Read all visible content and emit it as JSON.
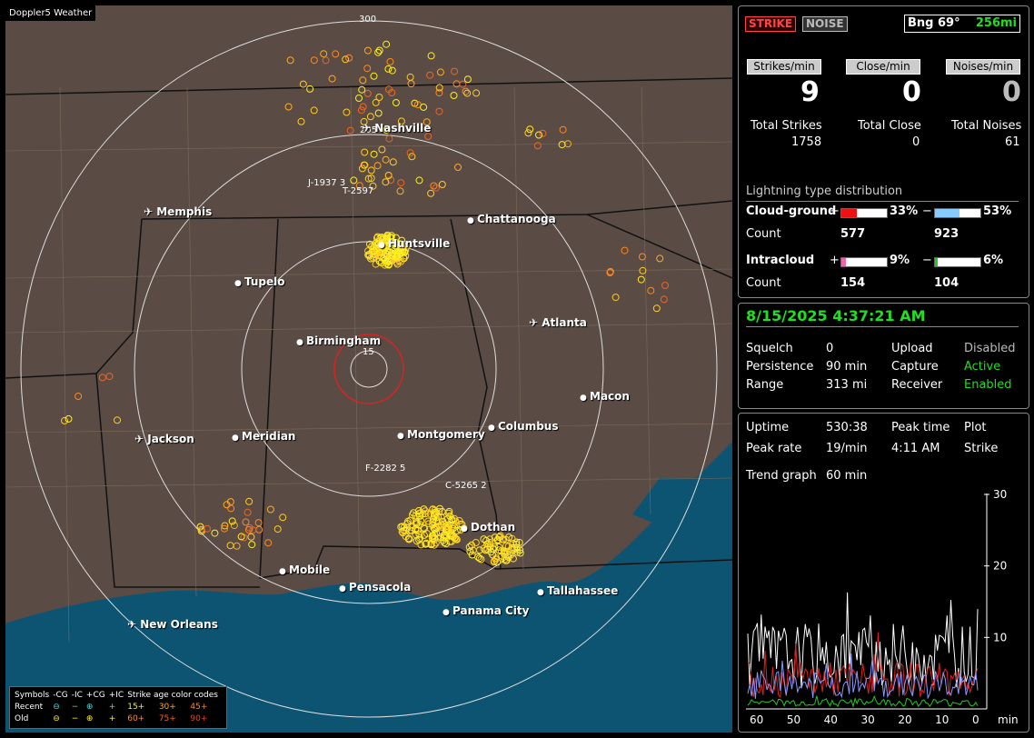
{
  "map_title": "Doppler5 Weather",
  "rings": [
    "300",
    "205",
    "15"
  ],
  "cities": [
    {
      "name": "Nashville",
      "airport": true
    },
    {
      "name": "Memphis",
      "airport": true
    },
    {
      "name": "Chattanooga",
      "airport": false
    },
    {
      "name": "Huntsville",
      "airport": false
    },
    {
      "name": "Tupelo",
      "airport": false
    },
    {
      "name": "Atlanta",
      "airport": true
    },
    {
      "name": "Birmingham",
      "airport": false
    },
    {
      "name": "Macon",
      "airport": false
    },
    {
      "name": "Jackson",
      "airport": true
    },
    {
      "name": "Meridian",
      "airport": false
    },
    {
      "name": "Montgomery",
      "airport": false
    },
    {
      "name": "Columbus",
      "airport": false
    },
    {
      "name": "Dothan",
      "airport": false
    },
    {
      "name": "Mobile",
      "airport": false
    },
    {
      "name": "Pensacola",
      "airport": false
    },
    {
      "name": "Tallahassee",
      "airport": false
    },
    {
      "name": "Panama City",
      "airport": false
    },
    {
      "name": "New Orleans",
      "airport": true
    }
  ],
  "cells": [
    "J-1937 3",
    "T-2597",
    "F-2282 5",
    "C-5265 2"
  ],
  "legend": {
    "symbols_label": "Symbols",
    "cols": [
      "-CG",
      "-IC",
      "+CG",
      "+IC"
    ],
    "age_label": "Strike age color codes",
    "recent_label": "Recent",
    "old_label": "Old",
    "recent_ages": [
      "15+",
      "30+",
      "45+"
    ],
    "old_ages": [
      "60+",
      "75+",
      "90+"
    ]
  },
  "panel": {
    "strike_btn": "STRIKE",
    "noise_btn": "NOISE",
    "bearing": "Bng 69°",
    "distance": "256mi",
    "rate_labels": [
      "Strikes/min",
      "Close/min",
      "Noises/min"
    ],
    "rates": [
      "9",
      "0",
      "0"
    ],
    "total_labels": [
      "Total Strikes",
      "Total Close",
      "Total Noises"
    ],
    "totals": [
      "1758",
      "0",
      "61"
    ],
    "dist_title": "Lightning type distribution",
    "cg_label": "Cloud-ground",
    "ic_label": "Intracloud",
    "count_label": "Count",
    "plus": "+",
    "minus": "−",
    "cg_pos_pct": "33%",
    "cg_neg_pct": "53%",
    "cg_pos_count": "577",
    "cg_neg_count": "923",
    "ic_pos_pct": "9%",
    "ic_neg_pct": "6%",
    "ic_pos_count": "154",
    "ic_neg_count": "104",
    "cg_pos_frac": 0.33,
    "cg_neg_frac": 0.53,
    "ic_pos_frac": 0.09,
    "ic_neg_frac": 0.06
  },
  "status": {
    "datetime": "8/15/2025 4:37:21 AM",
    "squelch_label": "Squelch",
    "squelch": "0",
    "persistence_label": "Persistence",
    "persistence": "90 min",
    "range_label": "Range",
    "range": "313 mi",
    "upload_label": "Upload",
    "upload": "Disabled",
    "capture_label": "Capture",
    "capture": "Active",
    "receiver_label": "Receiver",
    "receiver": "Enabled"
  },
  "stats": {
    "uptime_label": "Uptime",
    "uptime": "530:38",
    "peak_time_label": "Peak time",
    "peak_time": "4:11 AM",
    "plot_label": "Plot",
    "plot": "Strike",
    "peak_rate_label": "Peak rate",
    "peak_rate": "19/min",
    "trend_label": "Trend graph",
    "trend": "60 min"
  },
  "chart_data": {
    "type": "line",
    "x_ticks": [
      "60",
      "50",
      "40",
      "30",
      "20",
      "10",
      "0"
    ],
    "x_unit": "min",
    "y_ticks": [
      "10",
      "20",
      "30"
    ],
    "ylim": [
      0,
      30
    ],
    "series_colors": [
      "#ffffff",
      "#dd2222",
      "#8899ff",
      "#22cc22"
    ]
  }
}
